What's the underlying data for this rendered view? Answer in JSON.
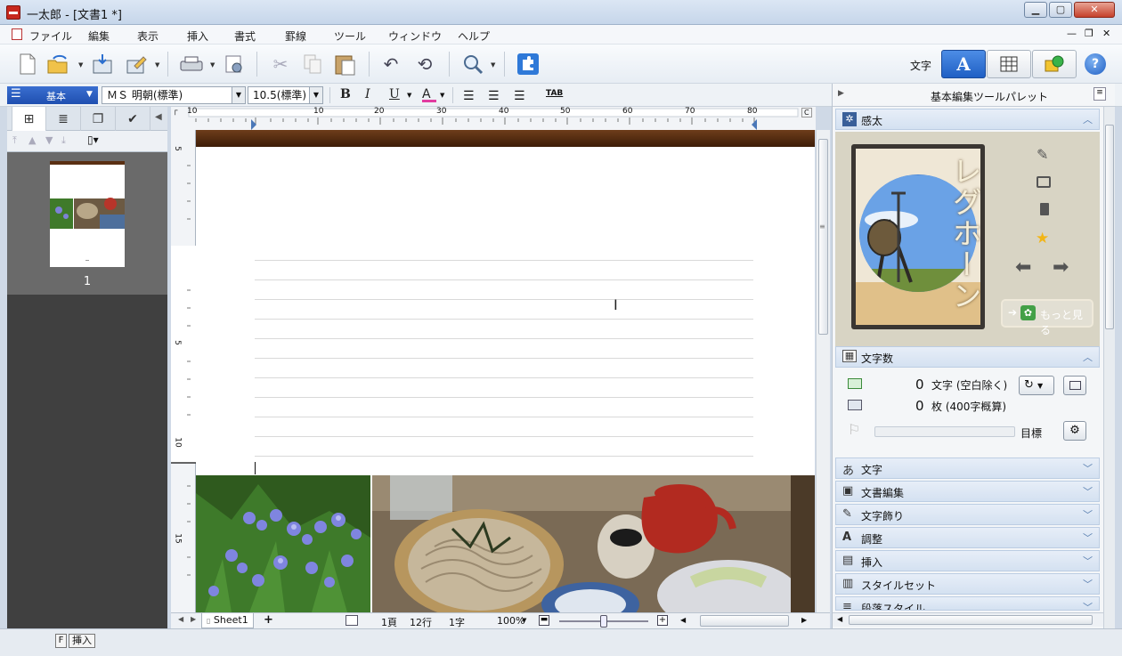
{
  "window": {
    "title": "一太郎 - [文書1 *]",
    "controls": [
      "minimize",
      "maximize",
      "close"
    ]
  },
  "menu": [
    "ファイル",
    "編集",
    "表示",
    "挿入",
    "書式",
    "罫線",
    "ツール",
    "ウィンドウ",
    "ヘルプ"
  ],
  "toolbar": {
    "mode_label": "文字",
    "mode_buttons": [
      "A",
      "grid",
      "object"
    ],
    "help": "?"
  },
  "format_bar": {
    "style_name": "基本",
    "font": "ＭＳ 明朝(標準)",
    "size": "10.5(標準)",
    "buttons": [
      "B",
      "I",
      "U"
    ],
    "tab": "TAB"
  },
  "left_panel": {
    "page_number": "1"
  },
  "ruler": {
    "top_ticks": [
      "10",
      "10",
      "20",
      "30",
      "40",
      "50",
      "60",
      "70",
      "80"
    ],
    "left_ticks": [
      "5",
      "5",
      "10",
      "15"
    ],
    "corner": "C"
  },
  "bottom_bar": {
    "sheet": "Sheet1",
    "add": "+",
    "page": "1頁",
    "line": "12行",
    "char": "1字",
    "zoom": "100%",
    "zoom_level": 0.5
  },
  "status": {
    "key": "F",
    "mode": "挿入"
  },
  "palette": {
    "title": "基本編集ツールパレット",
    "kanta": {
      "header": "感太",
      "card_title": "レグホーン",
      "more": "もっと見る"
    },
    "mojisu": {
      "header": "文字数",
      "count_value": "0",
      "count_label": "文字 (空白除く)",
      "sheet_value": "0",
      "sheet_label": "枚 (400字概算)",
      "goal_label": "目標"
    },
    "sections": [
      "文字",
      "文書編集",
      "文字飾り",
      "調整",
      "挿入",
      "スタイルセット",
      "段落スタイル"
    ],
    "section_icons": [
      "あ",
      "▣",
      "✎",
      "A",
      "▤",
      "▥",
      "≡"
    ]
  },
  "colors": {
    "accent": "#1f4fb0",
    "header_band": "#5a2f12",
    "close": "#c5412b"
  }
}
